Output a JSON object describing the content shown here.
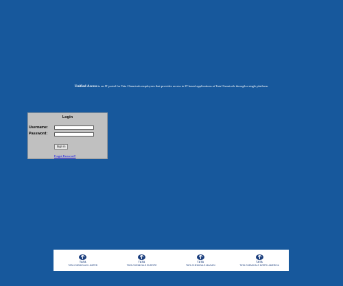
{
  "intro": {
    "brand": "Unified Access",
    "text": " is an IT portal for Tata Chemicals employees that provides access to IT based applications at Tata Chemicals through a single platform."
  },
  "login": {
    "title": "Login",
    "username_label": "Username:",
    "username_value": "",
    "password_label": "Password:",
    "password_value": "",
    "signin_label": "Sign in",
    "forgot_label": "Forgot Password?"
  },
  "footer": {
    "logo_word": "TATA",
    "companies": [
      {
        "name": "TATA CHEMICALS LIMITED"
      },
      {
        "name": "TATA CHEMICALS EUROPE"
      },
      {
        "name": "TATA CHEMICALS MAGADI"
      },
      {
        "name": "TATA CHEMICALS NORTH AMERICA"
      }
    ]
  },
  "colors": {
    "page_background": "#17589c",
    "panel_background": "#c0c0c0",
    "link": "#0000ee",
    "brand_blue": "#1a3d7c"
  }
}
